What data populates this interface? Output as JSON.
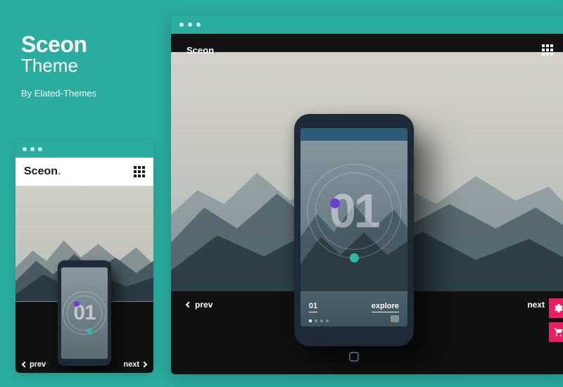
{
  "title": {
    "name": "Sceon",
    "subtitle": "Theme",
    "byline": "By Elated-Themes"
  },
  "brand": {
    "name": "Sceon",
    "dot": "."
  },
  "nav": {
    "prev": "prev",
    "next": "next"
  },
  "slide": {
    "big_number": "01",
    "index_label": "01",
    "explore_label": "explore"
  },
  "colors": {
    "accent": "#2aac9f",
    "pink": "#e91e63",
    "purple_dot": "#6a3fd6",
    "teal_dot": "#2fb9a4"
  },
  "icons": {
    "grid": "grid-icon",
    "prev": "chevron-left-icon",
    "next": "chevron-right-icon",
    "settings": "gear-icon",
    "cart": "cart-icon",
    "camera": "camera-icon"
  }
}
